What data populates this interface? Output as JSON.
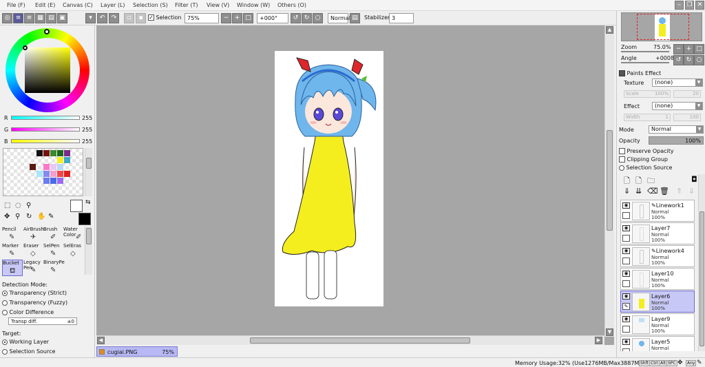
{
  "menu": {
    "items": [
      "File (F)",
      "Edit (E)",
      "Canvas (C)",
      "Layer (L)",
      "Selection (S)",
      "Filter (T)",
      "View (V)",
      "Window (W)",
      "Others (O)"
    ]
  },
  "toolbar": {
    "selection_label": "Selection",
    "selection_checked": true,
    "zoom": "75%",
    "rotation": "+000°",
    "blend": "Normal",
    "stabilizer_label": "Stabilizer",
    "stabilizer_value": "3"
  },
  "color": {
    "r_label": "R",
    "r_value": "255",
    "g_label": "G",
    "g_value": "255",
    "b_label": "B",
    "b_value": "255",
    "primary": "#ffffff",
    "secondary": "#000000"
  },
  "tools": [
    {
      "label": "Pencil"
    },
    {
      "label": "AirBrush"
    },
    {
      "label": "Brush"
    },
    {
      "label": "Water Color"
    },
    {
      "label": "Marker"
    },
    {
      "label": "Eraser"
    },
    {
      "label": "SelPen"
    },
    {
      "label": "SelEras"
    },
    {
      "label": "Bucket"
    },
    {
      "label": "Legacy Pen"
    },
    {
      "label": "BinaryPe"
    }
  ],
  "bucket": {
    "detection_title": "Detection Mode:",
    "modes": [
      "Transparency (Strict)",
      "Transparency (Fuzzy)",
      "Color Difference"
    ],
    "selected_mode": 0,
    "diff_label": "Transp diff.",
    "diff_value": "±0",
    "target_title": "Target:",
    "targets": [
      "Working Layer",
      "Selection Source"
    ],
    "selected_target": 0
  },
  "document_tab": {
    "name": "cugiai.PNG",
    "zoom": "75%"
  },
  "navigator": {
    "zoom_label": "Zoom",
    "zoom_value": "75.0%",
    "angle_label": "Angle",
    "angle_value": "+0008"
  },
  "paints_effect": {
    "title": "Paints Effect",
    "texture_label": "Texture",
    "texture_value": "(none)",
    "scale_label": "Scale",
    "scale_value": "100%",
    "scale_num": "20",
    "effect_label": "Effect",
    "effect_value": "(none)",
    "width_label": "Width",
    "width_value": "1",
    "width_num": "100"
  },
  "layer_props": {
    "mode_label": "Mode",
    "mode_value": "Normal",
    "opacity_label": "Opacity",
    "opacity_value": "100%",
    "preserve_opacity": "Preserve Opacity",
    "clipping_group": "Clipping Group",
    "selection_source": "Selection Source"
  },
  "layers": [
    {
      "name": "Linework1",
      "mode": "Normal",
      "opacity": "100%",
      "linework": true,
      "selected": false
    },
    {
      "name": "Layer7",
      "mode": "Normal",
      "opacity": "100%",
      "linework": false,
      "selected": false
    },
    {
      "name": "Linework4",
      "mode": "Normal",
      "opacity": "100%",
      "linework": true,
      "selected": false
    },
    {
      "name": "Layer10",
      "mode": "Normal",
      "opacity": "100%",
      "linework": false,
      "selected": false
    },
    {
      "name": "Layer6",
      "mode": "Normal",
      "opacity": "100%",
      "linework": false,
      "selected": true
    },
    {
      "name": "Layer9",
      "mode": "Normal",
      "opacity": "100%",
      "linework": false,
      "selected": false
    },
    {
      "name": "Layer5",
      "mode": "Normal",
      "opacity": "",
      "linework": false,
      "selected": false
    }
  ],
  "status": {
    "memory": "Memory Usage:32% (Use1276MB/Max3887MB)",
    "keys": [
      "Shft",
      "Ctrl",
      "Alt",
      "SPC",
      "Any"
    ]
  },
  "colors": {
    "hair": "#6fb6ec",
    "dress": "#f5ee1e",
    "bow": "#e0262a",
    "canvas_bg": "#a6a6a6"
  }
}
